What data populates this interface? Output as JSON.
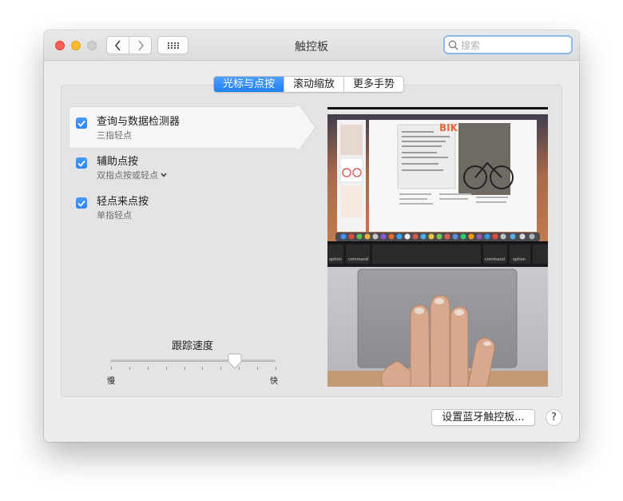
{
  "window": {
    "title": "触控板"
  },
  "search": {
    "placeholder": "搜索"
  },
  "tabs": [
    {
      "label": "光标与点按",
      "active": true
    },
    {
      "label": "滚动缩放",
      "active": false
    },
    {
      "label": "更多手势",
      "active": false
    }
  ],
  "options": [
    {
      "label": "查询与数据检测器",
      "sub": "三指轻点",
      "checked": true,
      "selected": true
    },
    {
      "label": "辅助点按",
      "sub": "双指点按或轻点",
      "checked": true,
      "has_dropdown": true
    },
    {
      "label": "轻点来点按",
      "sub": "单指轻点",
      "checked": true
    }
  ],
  "tracking": {
    "label": "跟踪速度",
    "min_label": "慢",
    "max_label": "快",
    "value": 0.75
  },
  "preview": {
    "keyboard_left_label": "command",
    "keyboard_right_label": "command",
    "option_left": "option",
    "option_right": "option",
    "magazine_title": "BIKES"
  },
  "buttons": {
    "bluetooth": "设置蓝牙触控板...",
    "help": "?"
  },
  "colors": {
    "accent": "#2a82f5",
    "close": "#fd5d55",
    "minimize": "#fdbc2e"
  }
}
